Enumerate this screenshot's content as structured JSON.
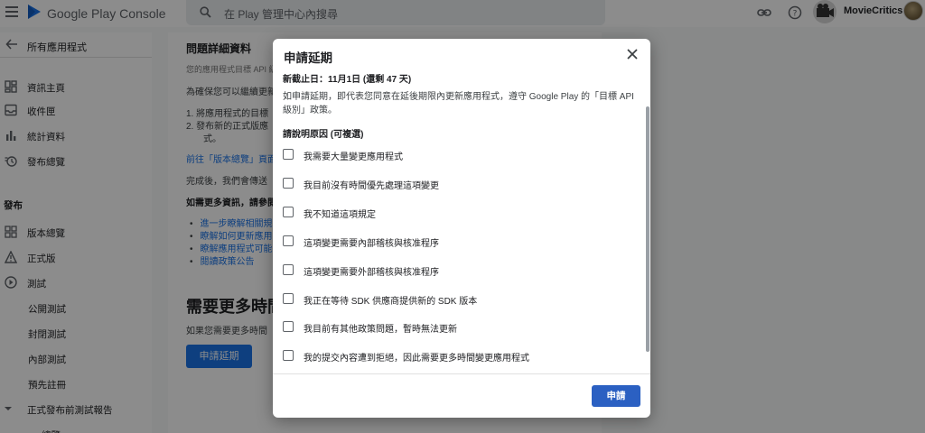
{
  "header": {
    "brand_prefix": "Google Play",
    "brand_suffix": "Console",
    "search_placeholder": "在 Play 管理中心內搜尋",
    "account_name": "MovieCritics"
  },
  "sidebar": {
    "back_label": "所有應用程式",
    "items": [
      {
        "label": "資訊主頁",
        "icon": "dashboard-icon"
      },
      {
        "label": "收件匣",
        "icon": "inbox-icon"
      },
      {
        "label": "統計資料",
        "icon": "bar-chart-icon"
      },
      {
        "label": "發布總覽",
        "icon": "publishing-overview-icon"
      }
    ],
    "section_release": "發布",
    "release_items": [
      {
        "label": "版本總覽",
        "icon": "release-overview-icon"
      },
      {
        "label": "正式版",
        "icon": "warning-icon"
      },
      {
        "label": "測試",
        "icon": "testing-icon"
      }
    ],
    "testing_sub": [
      "公開測試",
      "封閉測試",
      "內部測試"
    ],
    "more_items": [
      "預先註冊",
      "正式發布前測試報告",
      "總覽"
    ]
  },
  "background": {
    "card_title": "問題詳細資料",
    "line_top": "您的應用程式目標 API 級別...",
    "line_ensure": "為確保您可以繼續更新",
    "step1": "1.   將應用程式的目標",
    "step2": "2.   發布新的正式版應",
    "step2b": "式。",
    "link_release": "前往「版本總覽」頁面",
    "done_text": "完成後，我們會傳送",
    "more_info": "如需更多資訊，請參閱",
    "bullets": [
      "進一步瞭解相關規",
      "瞭解如何更新應用",
      "瞭解應用程式可能",
      "閱讀政策公告"
    ],
    "big_heading": "需要更多時間",
    "need_more": "如果您需要更多時間",
    "request_button": "申請延期"
  },
  "dialog": {
    "title": "申請延期",
    "deadline": "新截止日：11月1日 (還剩 47 天)",
    "description": "如申請延期，即代表您同意在延後期限內更新應用程式，遵守 Google Play 的「目標 API 級別」政策。",
    "reasons_header": "請說明原因 (可複選)",
    "options": [
      "我需要大量變更應用程式",
      "我目前沒有時間優先處理這項變更",
      "我不知道這項規定",
      "這項變更需要內部稽核與核准程序",
      "這項變更需要外部稽核與核准程序",
      "我正在等待 SDK 供應商提供新的 SDK 版本",
      "我目前有其他政策問題，暫時無法更新",
      "我的提交內容遭到拒絕，因此需要更多時間變更應用程式"
    ],
    "submit_label": "申請"
  },
  "colors": {
    "primary": "#1a73e8",
    "dialog_button": "#2b60c2",
    "scrim": "rgba(0,0,0,0.45)"
  }
}
